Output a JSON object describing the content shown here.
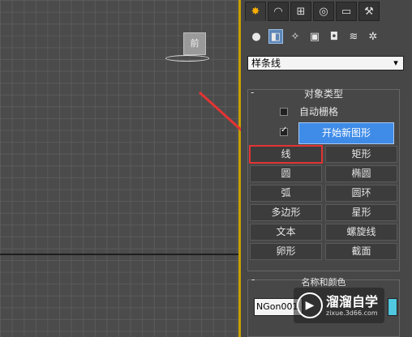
{
  "viewport": {
    "gizmo_label": "前"
  },
  "command_panel": {
    "top_tabs": [
      {
        "icon": "create-icon",
        "glyph": "✸",
        "active": true
      },
      {
        "icon": "modify-icon",
        "glyph": "◠",
        "active": false
      },
      {
        "icon": "hierarchy-icon",
        "glyph": "⊞",
        "active": false
      },
      {
        "icon": "motion-icon",
        "glyph": "◎",
        "active": false
      },
      {
        "icon": "display-icon",
        "glyph": "▭",
        "active": false
      },
      {
        "icon": "utilities-icon",
        "glyph": "⚒",
        "active": false
      }
    ],
    "sub_icons": [
      {
        "icon": "geometry-icon",
        "glyph": "●",
        "active": false
      },
      {
        "icon": "shapes-icon",
        "glyph": "◧",
        "active": true
      },
      {
        "icon": "lights-icon",
        "glyph": "✧",
        "active": false
      },
      {
        "icon": "cameras-icon",
        "glyph": "▣",
        "active": false
      },
      {
        "icon": "helpers-icon",
        "glyph": "◘",
        "active": false
      },
      {
        "icon": "space-warps-icon",
        "glyph": "≋",
        "active": false
      },
      {
        "icon": "systems-icon",
        "glyph": "✲",
        "active": false
      }
    ],
    "category_dropdown": {
      "value": "样条线"
    },
    "object_type": {
      "collapse": "-",
      "title": "对象类型",
      "auto_grid": {
        "label": "自动栅格",
        "checked": false
      },
      "start_new_shape": {
        "checked": true,
        "label": "开始新图形"
      },
      "buttons": [
        "线",
        "矩形",
        "圆",
        "椭圆",
        "弧",
        "圆环",
        "多边形",
        "星形",
        "文本",
        "螺旋线",
        "卵形",
        "截面"
      ]
    },
    "name_color": {
      "collapse": "-",
      "title": "名称和颜色",
      "name_value": "NGon001",
      "color": "#4fc8e0"
    }
  },
  "watermark": {
    "title": "溜溜自学",
    "url": "zixue.3d66.com"
  },
  "colors": {
    "highlight": "#e53333",
    "start_button": "#3f8ce8",
    "viewport_border": "#c8a000"
  }
}
